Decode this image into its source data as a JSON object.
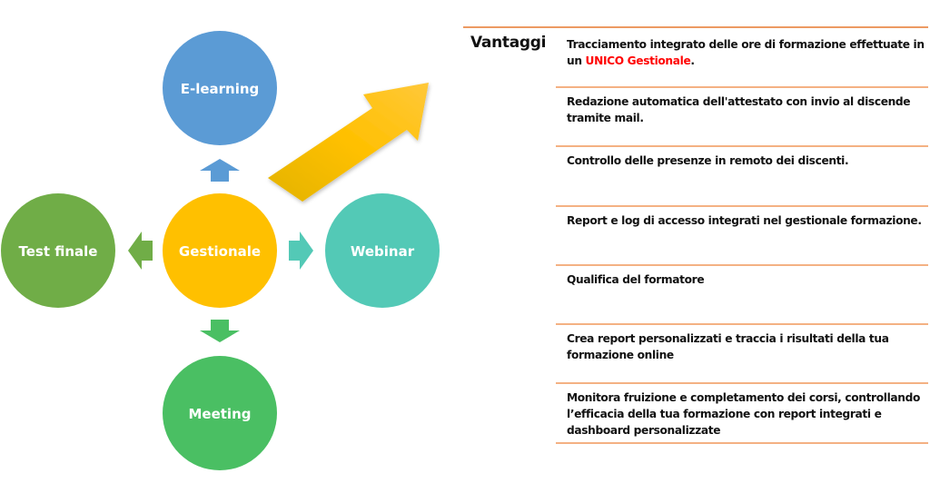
{
  "diagram": {
    "center": {
      "label": "Gestionale",
      "color": "#ffc000"
    },
    "nodes": [
      {
        "id": "elearning",
        "label": "E-learning",
        "color": "#5b9bd5"
      },
      {
        "id": "webinar",
        "label": "Webinar",
        "color": "#53c9b6"
      },
      {
        "id": "meeting",
        "label": "Meeting",
        "color": "#4abf63"
      },
      {
        "id": "test-finale",
        "label": "Test finale",
        "color": "#70ad47"
      }
    ],
    "big_arrow_color": "#ffc000"
  },
  "vantaggi": {
    "title": "Vantaggi",
    "line_color": "#f4b183",
    "highlight_color": "#ff0000",
    "rows": [
      {
        "before": "Tracciamento integrato delle ore di formazione effettuate in un ",
        "highlight": "UNICO Gestionale",
        "after": "."
      },
      {
        "text": "Redazione automatica dell'attestato con invio al discende tramite mail."
      },
      {
        "text": "Controllo delle presenze in remoto dei discenti."
      },
      {
        "text": "Report e log di accesso integrati nel gestionale formazione."
      },
      {
        "text": "Qualifica del formatore"
      },
      {
        "text": "Crea report personalizzati e traccia i risultati della tua formazione online"
      },
      {
        "text": "Monitora fruizione e completamento dei corsi, controllando l’efficacia della tua formazione con report integrati e dashboard personalizzate"
      }
    ]
  }
}
